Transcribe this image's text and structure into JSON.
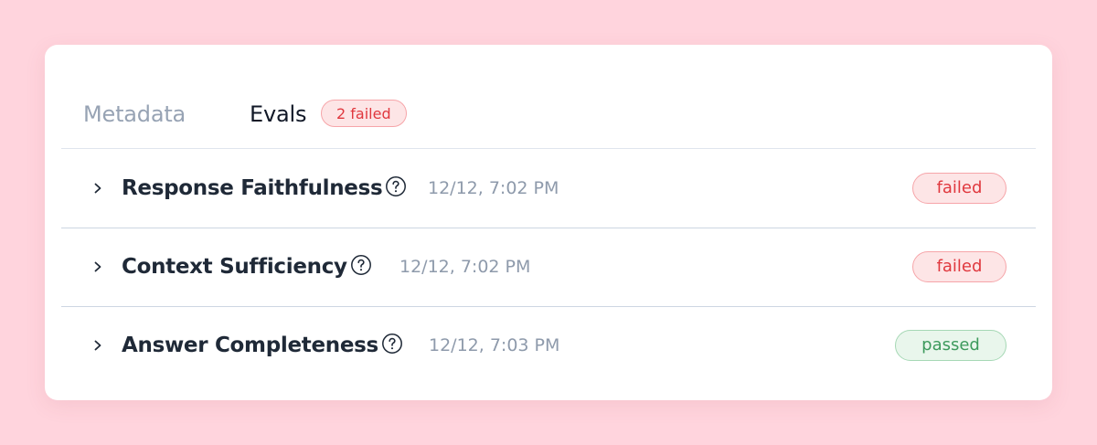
{
  "tabs": {
    "metadata_label": "Metadata",
    "evals_label": "Evals",
    "evals_badge": "2 failed"
  },
  "evals": [
    {
      "name": "Response Faithfulness",
      "timestamp": "12/12, 7:02 PM",
      "status": "failed"
    },
    {
      "name": "Context Sufficiency",
      "timestamp": "12/12, 7:02 PM",
      "status": "failed"
    },
    {
      "name": "Answer Completeness",
      "timestamp": "12/12, 7:03 PM",
      "status": "passed"
    }
  ],
  "icons": {
    "expand": "chevron-right-icon",
    "help": "question-circle-icon"
  },
  "colors": {
    "background": "#ffd4dd",
    "failed": "#e0383e",
    "passed": "#3d9a5c",
    "muted_text": "#8e9aab"
  }
}
